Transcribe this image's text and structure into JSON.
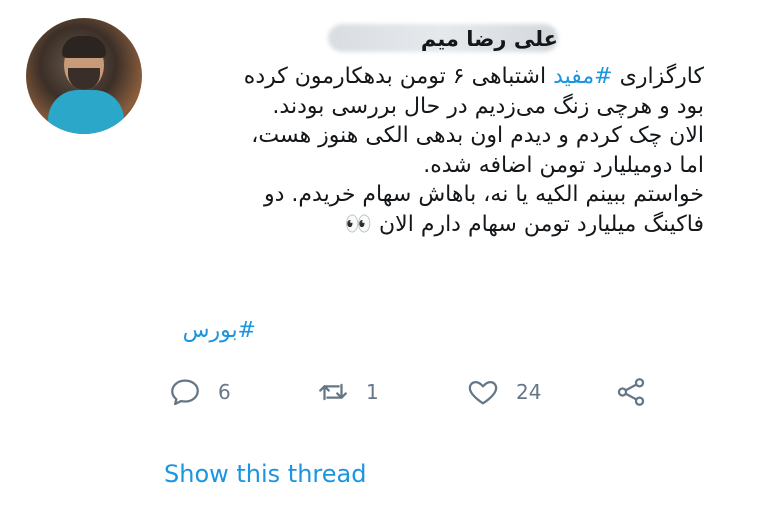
{
  "user": {
    "display_name": "علی رضا میم",
    "avatar_icon": "user-avatar-photo"
  },
  "tweet": {
    "lines": [
      {
        "prefix": "کارگزاری ",
        "hashtag": "#مفید",
        "suffix": " اشتباهی ۶ تومن بدهکارمون کرده"
      },
      {
        "text": "بود و هرچی زنگ می‌زدیم در حال بررسی بودند."
      },
      {
        "text": "الان چک کردم و دیدم اون بدهی الکی هنوز هست،"
      },
      {
        "text": "اما دومیلیارد تومن اضافه شده."
      },
      {
        "text": "خواستم ببینم الکیه یا نه، باهاش سهام خریدم. دو"
      },
      {
        "text": "فاکینگ میلیارد تومن سهام دارم الان 👀"
      }
    ],
    "tag": "#بورس"
  },
  "actions": {
    "reply_count": "6",
    "retweet_count": "1",
    "like_count": "24",
    "reply_icon": "reply-icon",
    "retweet_icon": "retweet-icon",
    "like_icon": "heart-icon",
    "share_icon": "share-icon"
  },
  "show_thread_label": "Show this thread",
  "colors": {
    "link": "#1b95e0",
    "text": "#14171a",
    "muted": "#657786"
  }
}
